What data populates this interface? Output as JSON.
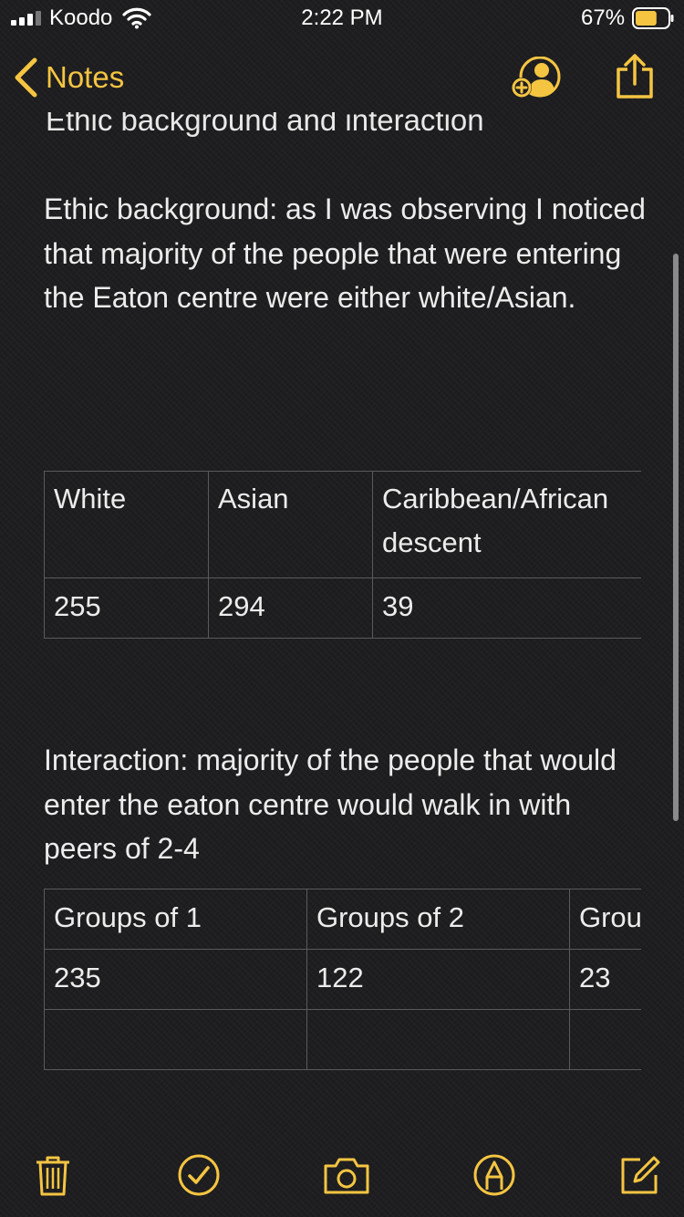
{
  "status": {
    "carrier": "Koodo",
    "time": "2:22 PM",
    "battery": "67%",
    "battery_level": 0.67
  },
  "nav": {
    "back_label": "Notes"
  },
  "note": {
    "cut_heading": "Ethic background and interaction",
    "paragraph1": "Ethic background: as I was observing I noticed that majority of the people that were entering the Eaton centre were either white/Asian.",
    "table1": {
      "headers": [
        "White",
        "Asian",
        "Caribbean/African descent"
      ],
      "values": [
        "255",
        "294",
        "39"
      ]
    },
    "paragraph2": "Interaction: majority of the people that would enter the eaton centre would walk in with peers of 2-4",
    "table2": {
      "headers": [
        "Groups of 1",
        "Groups of 2",
        "Grou"
      ],
      "values": [
        "235",
        "122",
        "23"
      ],
      "empty_row": [
        "",
        "",
        ""
      ]
    }
  },
  "icons": {
    "signal": "signal-bars-icon",
    "wifi": "wifi-icon",
    "battery": "battery-icon",
    "back": "chevron-left-icon",
    "add_person": "add-person-icon",
    "share": "share-icon",
    "trash": "trash-icon",
    "checklist": "checkmark-circle-icon",
    "camera": "camera-icon",
    "markup": "markup-pen-icon",
    "compose": "compose-icon"
  },
  "colors": {
    "accent": "#f5c542",
    "background": "#1e1e20",
    "text": "#ececec"
  }
}
